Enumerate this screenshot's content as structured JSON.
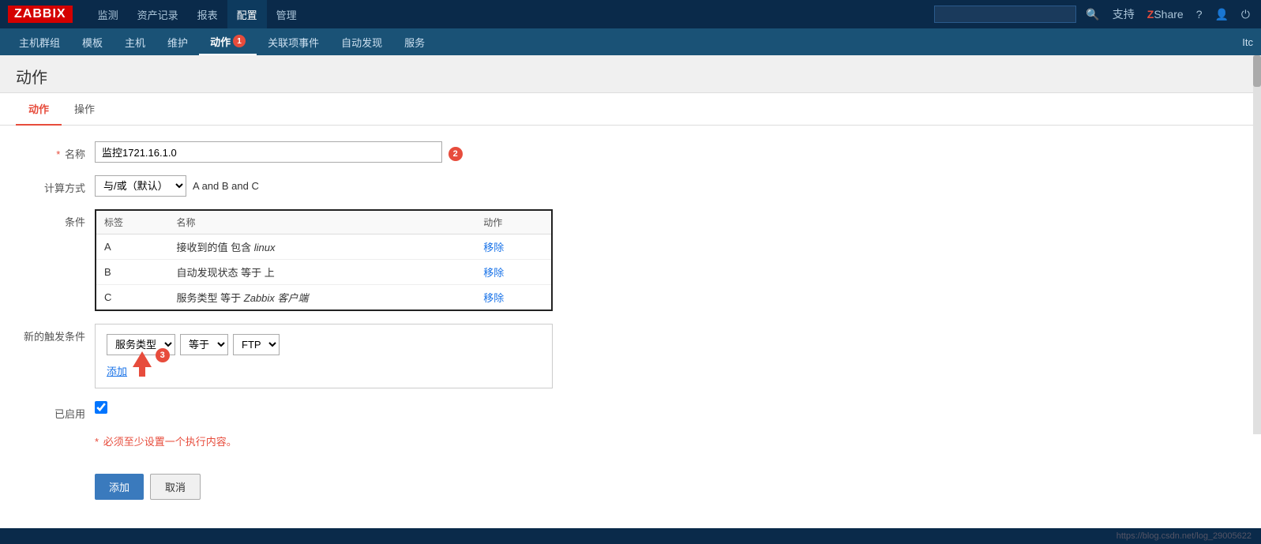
{
  "logo": {
    "text": "ZABBIX"
  },
  "top_nav": {
    "items": [
      {
        "label": "监测",
        "active": false
      },
      {
        "label": "资产记录",
        "active": false
      },
      {
        "label": "报表",
        "active": false
      },
      {
        "label": "配置",
        "active": true
      },
      {
        "label": "管理",
        "active": false
      }
    ],
    "search_placeholder": "",
    "support_label": "支持",
    "share_label": "Share"
  },
  "second_nav": {
    "items": [
      {
        "label": "主机群组",
        "active": false
      },
      {
        "label": "模板",
        "active": false
      },
      {
        "label": "主机",
        "active": false
      },
      {
        "label": "维护",
        "active": false
      },
      {
        "label": "动作",
        "active": true,
        "badge": "1"
      },
      {
        "label": "关联项事件",
        "active": false
      },
      {
        "label": "自动发现",
        "active": false
      },
      {
        "label": "服务",
        "active": false
      }
    ],
    "right_text": "Itc"
  },
  "page": {
    "title": "动作",
    "tabs": [
      {
        "label": "动作",
        "active": true
      },
      {
        "label": "操作",
        "active": false
      }
    ]
  },
  "form": {
    "name_label": "名称",
    "name_badge": "2",
    "name_value": "监控1721.16.1.0",
    "calc_label": "计算方式",
    "calc_option": "与/或（默认）",
    "calc_expression": "A and B and C",
    "conditions_label": "条件",
    "conditions_headers": {
      "tag": "标签",
      "name": "名称",
      "action": "动作"
    },
    "conditions_rows": [
      {
        "tag": "A",
        "name": "接收到的值 包含 linux",
        "italic_parts": "linux",
        "action": "移除"
      },
      {
        "tag": "B",
        "name": "自动发现状态 等于 上",
        "action": "移除"
      },
      {
        "tag": "C",
        "name": "服务类型 等于 Zabbix 客户端",
        "italic_parts": "Zabbix 客户端",
        "action": "移除"
      }
    ],
    "new_trigger_label": "新的触发条件",
    "trigger_select1_value": "服务类型",
    "trigger_select2_value": "等于",
    "trigger_select3_value": "FTP",
    "add_link": "添加",
    "add_badge": "3",
    "enabled_label": "已启用",
    "enabled_checked": true,
    "warning": "必须至少设置一个执行内容。",
    "add_button": "添加",
    "cancel_button": "取消"
  },
  "footer": {
    "url": "https://blog.csdn.net/log_29005622"
  }
}
